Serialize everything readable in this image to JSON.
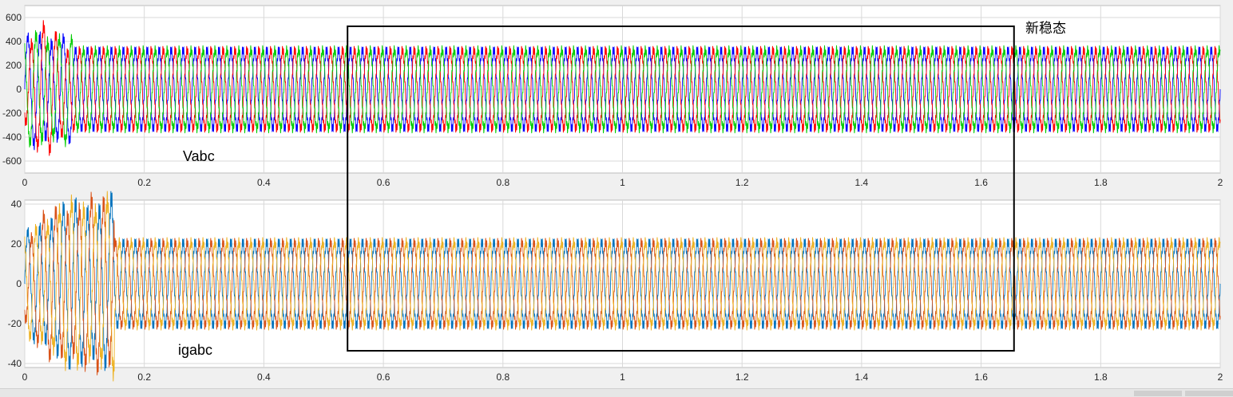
{
  "chart_data": [
    {
      "type": "line",
      "title": "",
      "xlabel": "",
      "ylabel": "",
      "annotation": "Vabc",
      "xlim": [
        0,
        2
      ],
      "ylim": [
        -700,
        700
      ],
      "x_ticks": [
        0,
        0.2,
        0.4,
        0.6,
        0.8,
        1,
        1.2,
        1.4,
        1.6,
        1.8,
        2
      ],
      "x_tick_labels": [
        "0",
        "0.2",
        "0.4",
        "0.6",
        "0.8",
        "1",
        "1.2",
        "1.4",
        "1.6",
        "1.8",
        "2"
      ],
      "y_ticks": [
        -600,
        -400,
        -200,
        0,
        200,
        400,
        600
      ],
      "y_tick_labels": [
        "-600",
        "-400",
        "-200",
        "0",
        "200",
        "400",
        "600"
      ],
      "grid": true,
      "signal": {
        "frequency_hz": 50,
        "steady_amplitude": 330,
        "initial_transient_peak": 560,
        "transient_end_s": 0.08
      },
      "series": [
        {
          "phase_deg": 0,
          "color": "#0000ff"
        },
        {
          "phase_deg": -120,
          "color": "#ff0000"
        },
        {
          "phase_deg": 120,
          "color": "#00cc00"
        }
      ]
    },
    {
      "type": "line",
      "title": "",
      "xlabel": "",
      "ylabel": "",
      "annotation": "igabc",
      "xlim": [
        0,
        2
      ],
      "ylim": [
        -42,
        42
      ],
      "x_ticks": [
        0,
        0.2,
        0.4,
        0.6,
        0.8,
        1,
        1.2,
        1.4,
        1.6,
        1.8,
        2
      ],
      "x_tick_labels": [
        "0",
        "0.2",
        "0.4",
        "0.6",
        "0.8",
        "1",
        "1.2",
        "1.4",
        "1.6",
        "1.8",
        "2"
      ],
      "y_ticks": [
        -40,
        -20,
        0,
        20,
        40
      ],
      "y_tick_labels": [
        "-40",
        "-20",
        "0",
        "20",
        "40"
      ],
      "grid": true,
      "signal": {
        "frequency_hz": 50,
        "steady_amplitude": 21,
        "initial_transient_peak": 33,
        "transient_end_s": 0.15
      },
      "series": [
        {
          "phase_deg": 0,
          "color": "#0072bd"
        },
        {
          "phase_deg": -120,
          "color": "#d95319"
        },
        {
          "phase_deg": 120,
          "color": "#edb120"
        }
      ]
    }
  ],
  "highlight": {
    "label": "新稳态",
    "x_range": [
      0.54,
      1.655
    ]
  },
  "colors": {
    "panel_background": "#ffffff",
    "figure_background": "#f0f0f0",
    "grid": "#d9d9d9",
    "highlight_box": "#000000"
  }
}
